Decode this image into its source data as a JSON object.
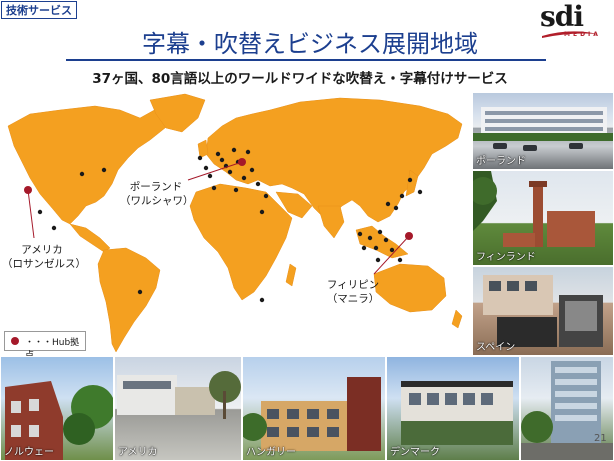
{
  "header": {
    "section_tag": "技術サービス",
    "title": "字幕・吹替えビジネス展開地域",
    "subtitle": "37ヶ国、80言語以上のワールドワイドな吹替え・字幕付けサービス"
  },
  "logo": {
    "text": "sdi",
    "subtext": "MEDIA"
  },
  "map": {
    "labels": {
      "poland": [
        "ポーランド",
        "（ワルシャワ）"
      ],
      "usa": [
        "アメリカ",
        "（ロサンゼルス）"
      ],
      "philippines": [
        "フィリピン",
        "（マニラ）"
      ]
    },
    "legend": "・・・Hub拠点"
  },
  "photos": [
    {
      "id": "poland",
      "caption": "ポーランド"
    },
    {
      "id": "finland",
      "caption": "フィンランド"
    },
    {
      "id": "spain",
      "caption": "スペイン"
    },
    {
      "id": "norway",
      "caption": "ノルウェー"
    },
    {
      "id": "america",
      "caption": "アメリカ"
    },
    {
      "id": "hungary",
      "caption": "ハンガリー"
    },
    {
      "id": "denmark",
      "caption": "デンマーク"
    },
    {
      "id": "extra",
      "caption": ""
    }
  ],
  "page_number": "21",
  "colors": {
    "brand_blue": "#1c3f8f",
    "map_orange": "#f4a020",
    "hub_red": "#a5192a"
  }
}
